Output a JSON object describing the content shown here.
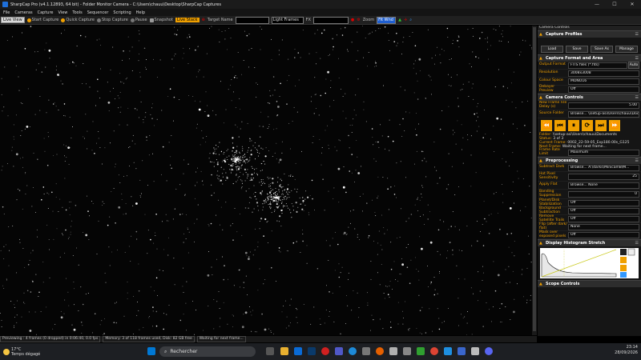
{
  "window": {
    "title": "SharpCap Pro (v4.1.12893, 64 bit) - Folder Monitor Camera - C:\\Users\\chauu\\Desktop\\SharpCap Captures",
    "controls": [
      "—",
      "☐",
      "✕"
    ]
  },
  "menu": [
    "File",
    "Cameras",
    "Capture",
    "View",
    "Tools",
    "Sequencer",
    "Scripting",
    "Help"
  ],
  "toolbar": {
    "live_view": "Live View",
    "start_capture": "Start Capture",
    "quick_capture": "Quick Capture",
    "stop_capture": "Stop Capture",
    "pause": "Pause",
    "snapshot": "Snapshot",
    "live_stack": "Live Stack",
    "target_name_label": "Target Name",
    "target_name_value": "",
    "frame_type": "Light Frames",
    "fx_label": "FX",
    "fx_value": "",
    "zoom_label": "Zoom",
    "zoom_value": "Fit Wnd"
  },
  "status": {
    "preview": "Previewing : 4 frames (0 dropped) in 0:06:40, 0.0 fps",
    "memory": "Memory: 3 of 118 frames used, Disk: 82 GB free",
    "waiting": "Waiting for next frame..."
  },
  "panel": {
    "title": "Camera Controls",
    "capture_profiles": {
      "heading": "Capture Profiles",
      "buttons": [
        "Load",
        "Save",
        "Save As",
        "Manage"
      ]
    },
    "capture_format": {
      "heading": "Capture Format and Area",
      "rows": [
        {
          "label": "Output Format",
          "value": "FITS files (*.fits)"
        },
        {
          "label": "Resolution",
          "value": "3008x3008"
        },
        {
          "label": "Colour Space",
          "value": "MONO16"
        },
        {
          "label": "Debayer Preview",
          "value": "Off"
        }
      ],
      "auto_label": "Auto"
    },
    "camera_controls": {
      "heading": "Camera Controls",
      "rows": [
        {
          "label": "New Frame File Delay (s)",
          "value": "5.00"
        },
        {
          "label": "Source Folder",
          "value": "Browse...  \\\\setup-asi\\Users\\chauu\\Docume"
        }
      ],
      "media_buttons": [
        "⏪",
        "⏮",
        "⏸",
        "⟳",
        "⏭",
        "⏩"
      ],
      "folder_label": "Folder:",
      "folder_value": "\\\\setup-asi\\Users\\chauu\\Documents",
      "status_label": "Status:",
      "status_value": "3 of 3",
      "current_frame_label": "Current Frame:",
      "current_frame_value": "0002_22-59-05_Exp180.00s_G125",
      "next_frame_label": "Next Frame:",
      "next_frame_value": "Waiting for next frame...",
      "frame_rate_label": "Frame Rate Limit",
      "frame_rate_value": "Maximum"
    },
    "preprocessing": {
      "heading": "Preprocessing",
      "rows": [
        {
          "label": "Subtract Dark",
          "value": "Browse...  A:\\darks\\Minicam8\\M..."
        },
        {
          "label": "Hot Pixel Sensitivity",
          "value": "25"
        },
        {
          "label": "Apply Flat",
          "value": "Browse...  None"
        },
        {
          "label": "Banding Suppression",
          "value": "0"
        },
        {
          "label": "Planet/Disk Stabilization",
          "value": "Off"
        },
        {
          "label": "Background Subtraction",
          "value": "Off"
        },
        {
          "label": "Remove Satellite Trails",
          "value": "Off"
        },
        {
          "label": "Flip (after dark/ flat)",
          "value": "None"
        },
        {
          "label": "Mask over exposed pixels",
          "value": "Off"
        }
      ]
    },
    "histogram": {
      "heading": "Display Histogram Stretch"
    },
    "scope_controls": {
      "heading": "Scope Controls"
    }
  },
  "taskbar": {
    "temp": "17°C",
    "weather": "Temps dégagé",
    "search_placeholder": "Rechercher",
    "time": "23:14",
    "date": "28/09/2026"
  },
  "colors": {
    "accent_orange": "#f0a000",
    "panel_bg": "#151515",
    "toolbar_bg": "#202020"
  }
}
